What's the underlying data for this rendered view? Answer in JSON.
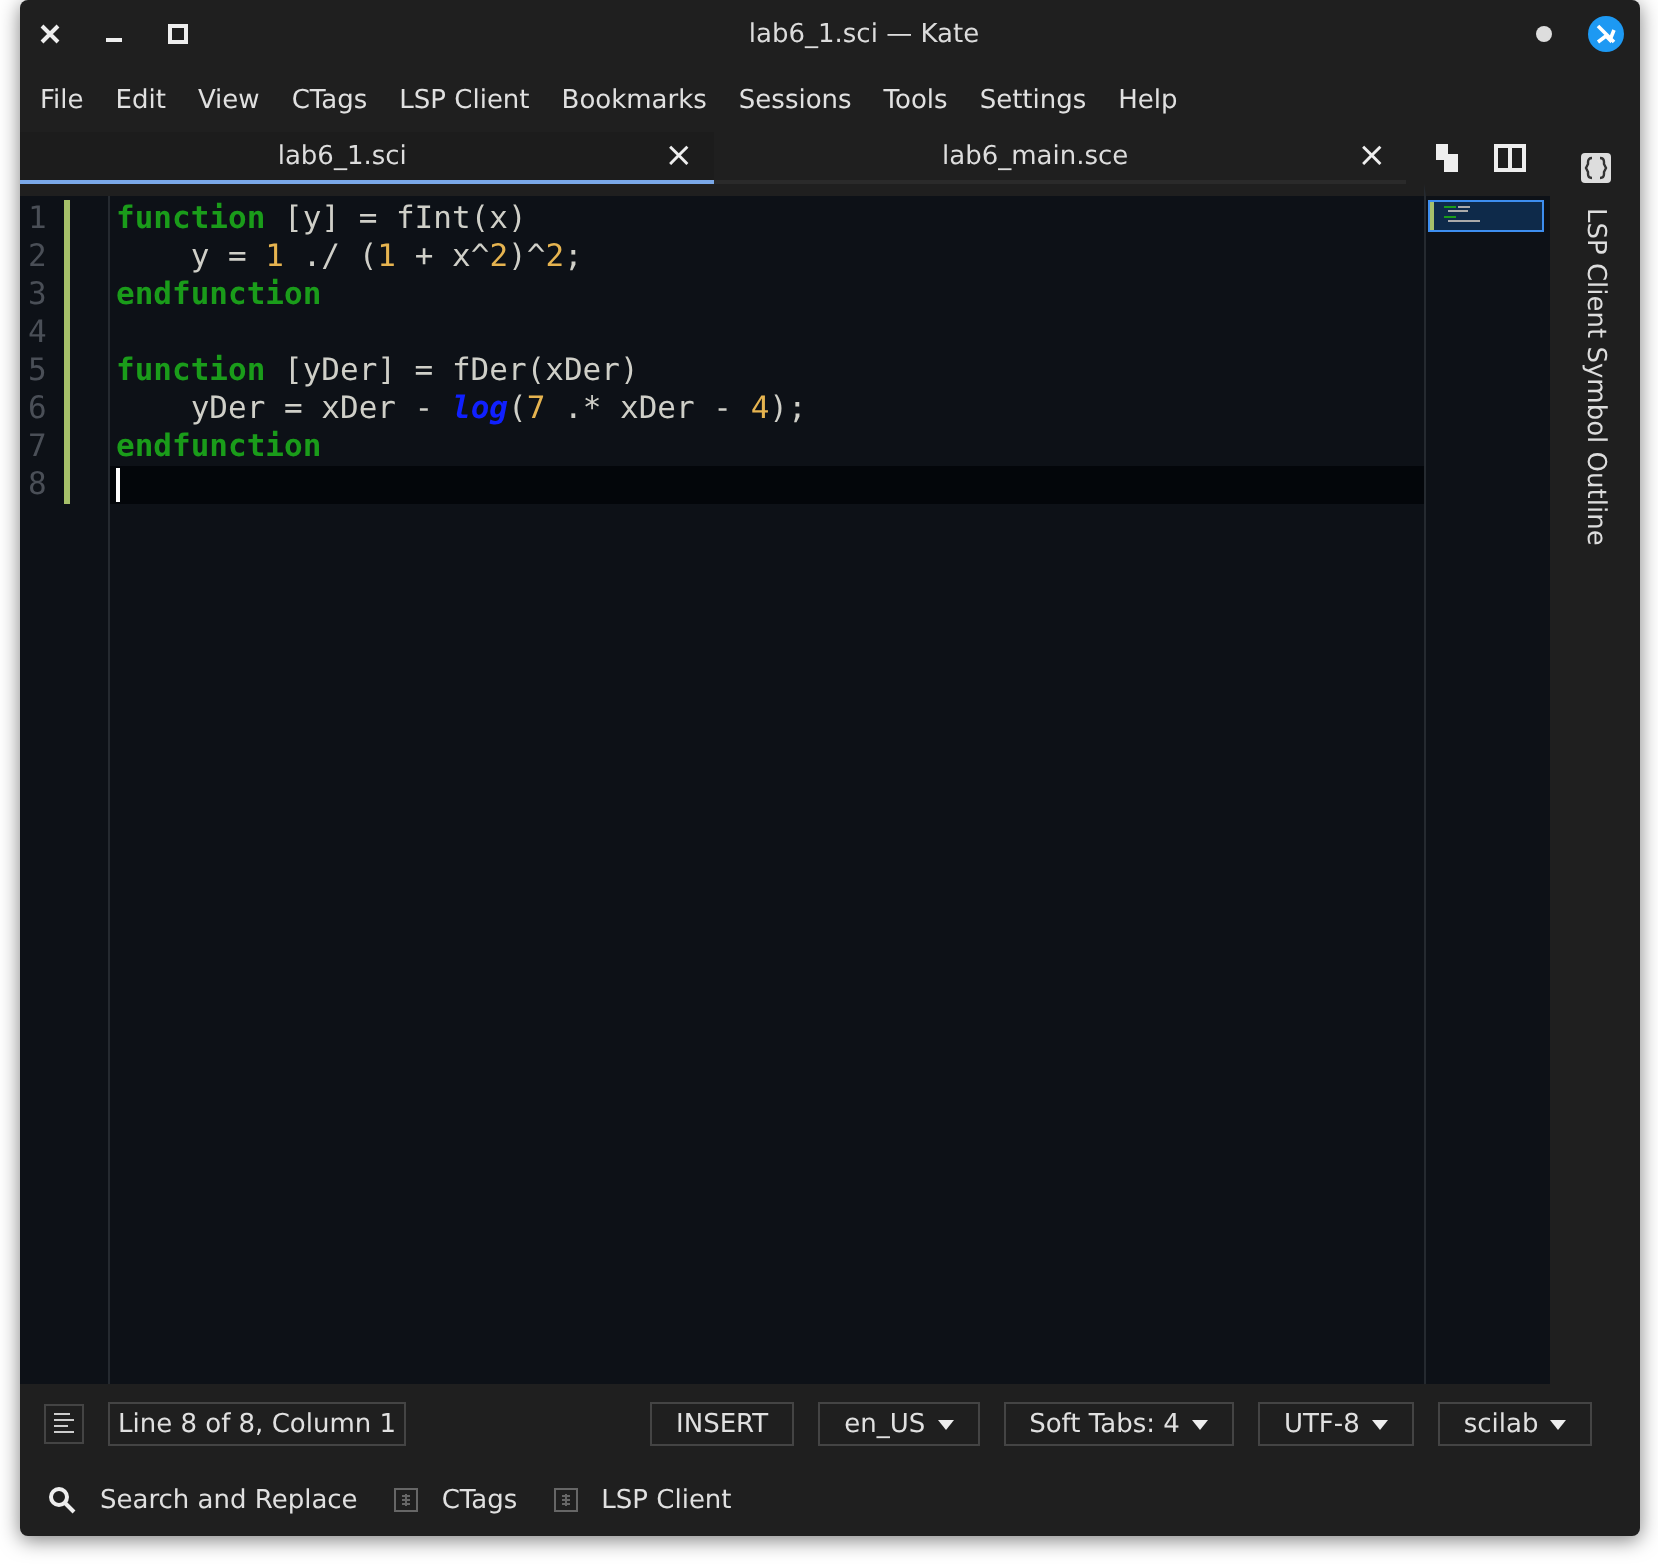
{
  "window": {
    "title": "lab6_1.sci — Kate",
    "modified": true
  },
  "menu": [
    "File",
    "Edit",
    "View",
    "CTags",
    "LSP Client",
    "Bookmarks",
    "Sessions",
    "Tools",
    "Settings",
    "Help"
  ],
  "tabs": [
    {
      "label": "lab6_1.sci",
      "close": "×",
      "selected": true
    },
    {
      "label": "lab6_main.sce",
      "close": "×",
      "selected": false
    }
  ],
  "editor": {
    "lines": [
      {
        "number": "1",
        "tokens": [
          {
            "kind": "keyword",
            "text": "function"
          },
          {
            "kind": "plain",
            "text": " [y] = fInt(x)"
          }
        ]
      },
      {
        "number": "2",
        "tokens": [
          {
            "kind": "plain",
            "text": "    y = "
          },
          {
            "kind": "number",
            "text": "1"
          },
          {
            "kind": "plain",
            "text": " ./ ("
          },
          {
            "kind": "number",
            "text": "1"
          },
          {
            "kind": "plain",
            "text": " + x^"
          },
          {
            "kind": "number",
            "text": "2"
          },
          {
            "kind": "plain",
            "text": ")^"
          },
          {
            "kind": "number",
            "text": "2"
          },
          {
            "kind": "plain",
            "text": ";"
          }
        ]
      },
      {
        "number": "3",
        "tokens": [
          {
            "kind": "keyword",
            "text": "endfunction"
          }
        ]
      },
      {
        "number": "4"
      },
      {
        "number": "5",
        "tokens": [
          {
            "kind": "keyword",
            "text": "function"
          },
          {
            "kind": "plain",
            "text": " [yDer] = fDer(xDer)"
          }
        ]
      },
      {
        "number": "6",
        "tokens": [
          {
            "kind": "plain",
            "text": "    yDer = xDer - "
          },
          {
            "kind": "builtin",
            "text": "log"
          },
          {
            "kind": "plain",
            "text": "("
          },
          {
            "kind": "number",
            "text": "7"
          },
          {
            "kind": "plain",
            "text": " .* xDer - "
          },
          {
            "kind": "number",
            "text": "4"
          },
          {
            "kind": "plain",
            "text": ");"
          }
        ]
      },
      {
        "number": "7",
        "tokens": [
          {
            "kind": "keyword",
            "text": "endfunction"
          }
        ]
      },
      {
        "number": "8",
        "current": true
      }
    ]
  },
  "side_panel": {
    "label": "LSP Client Symbol Outline"
  },
  "status_bar": {
    "position": "Line 8 of 8, Column 1",
    "mode": "INSERT",
    "dropdowns": [
      "en_US",
      "Soft Tabs: 4",
      "UTF-8",
      "scilab"
    ]
  },
  "tool_views": [
    {
      "kind": "search",
      "label": "Search and Replace"
    },
    {
      "kind": "panel",
      "label": "CTags"
    },
    {
      "kind": "panel",
      "label": "LSP Client"
    }
  ]
}
